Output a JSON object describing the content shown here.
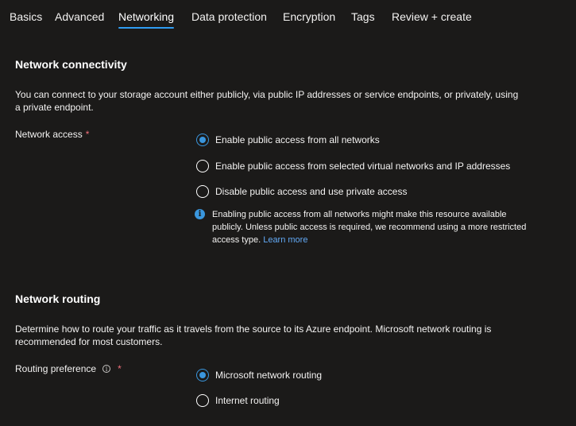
{
  "tabs": [
    {
      "label": "Basics"
    },
    {
      "label": "Advanced"
    },
    {
      "label": "Networking"
    },
    {
      "label": "Data protection"
    },
    {
      "label": "Encryption"
    },
    {
      "label": "Tags"
    },
    {
      "label": "Review + create"
    }
  ],
  "active_tab": "Networking",
  "connectivity": {
    "title": "Network connectivity",
    "description": "You can connect to your storage account either publicly, via public IP addresses or service endpoints, or privately, using a private endpoint.",
    "field_label": "Network access",
    "required_mark": "*",
    "options": [
      {
        "label": "Enable public access from all networks",
        "checked": true
      },
      {
        "label": "Enable public access from selected virtual networks and IP addresses",
        "checked": false
      },
      {
        "label": "Disable public access and use private access",
        "checked": false
      }
    ],
    "info": {
      "text": "Enabling public access from all networks might make this resource available publicly. Unless public access is required, we recommend using a more restricted access type.",
      "link": "Learn more"
    }
  },
  "routing": {
    "title": "Network routing",
    "description": "Determine how to route your traffic as it travels from the source to its Azure endpoint. Microsoft network routing is recommended for most customers.",
    "field_label": "Routing preference",
    "required_mark": "*",
    "options": [
      {
        "label": "Microsoft network routing",
        "checked": true
      },
      {
        "label": "Internet routing",
        "checked": false
      }
    ]
  },
  "colors": {
    "background": "#1b1a19",
    "accent": "#3a96dd",
    "link": "#62a9f5",
    "required": "#f1707b"
  }
}
